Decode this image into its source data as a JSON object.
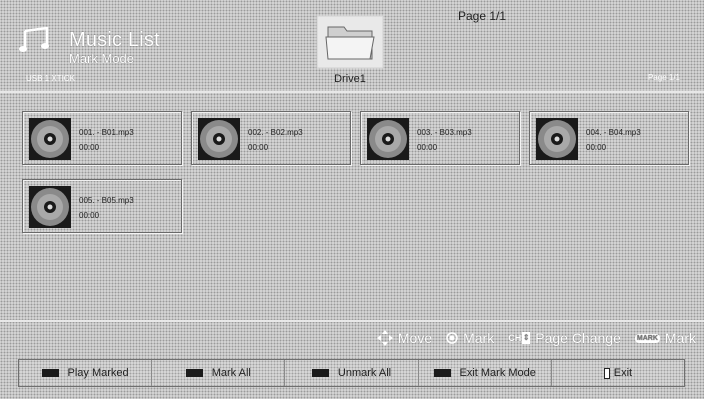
{
  "header": {
    "title": "Music List",
    "mode": "Mark Mode",
    "device": "USB 1 XTICK",
    "folder_label": "Drive1",
    "page_top": "Page 1/1",
    "page_right": "Page 1/1"
  },
  "files": [
    {
      "name": "001. - B01.mp3",
      "duration": "00:00"
    },
    {
      "name": "002. - B02.mp3",
      "duration": "00:00"
    },
    {
      "name": "003. - B03.mp3",
      "duration": "00:00"
    },
    {
      "name": "004. - B04.mp3",
      "duration": "00:00"
    },
    {
      "name": "005. - B05.mp3",
      "duration": "00:00"
    }
  ],
  "hints": {
    "move": "Move",
    "mark": "Mark",
    "ch_key": "CH",
    "page_change": "Page Change",
    "mark_key": "MARK",
    "mark2": "Mark"
  },
  "softkeys": {
    "play_marked": "Play Marked",
    "mark_all": "Mark All",
    "unmark_all": "Unmark All",
    "exit_mark_mode": "Exit Mark Mode",
    "exit": "Exit"
  },
  "icons": {
    "app": "music-note-icon",
    "folder": "folder-icon",
    "file": "cd-disc-icon",
    "move": "dpad-icon",
    "mark": "ok-circle-icon",
    "exit": "exit-icon"
  }
}
